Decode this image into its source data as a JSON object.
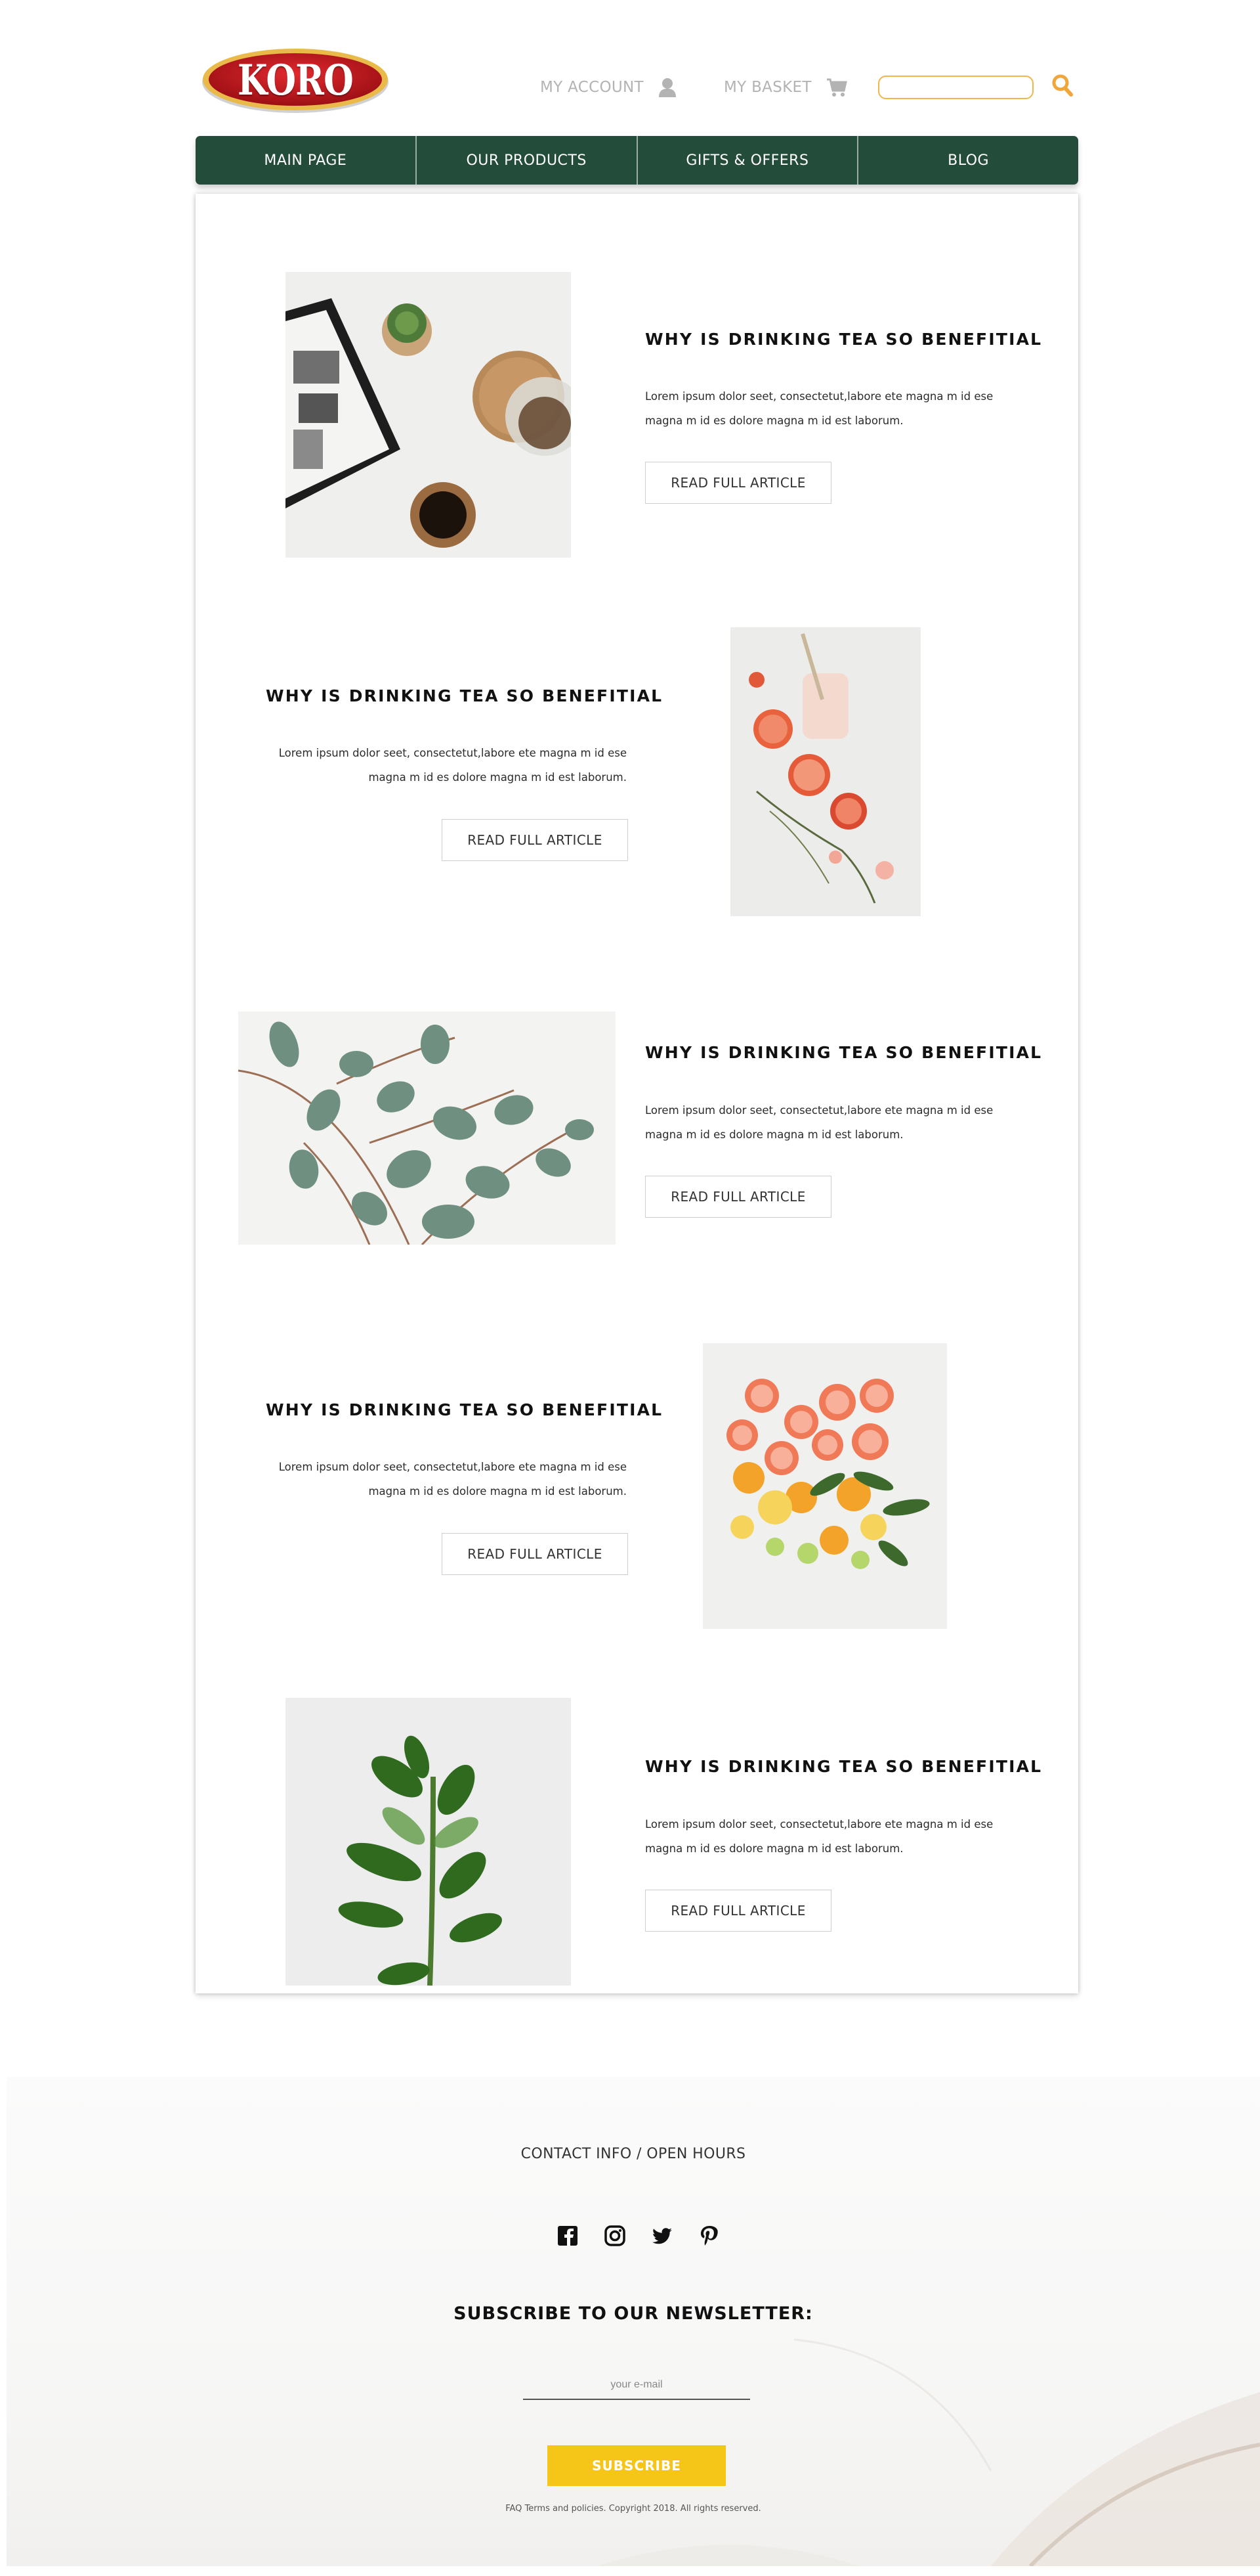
{
  "header": {
    "logo_text": "KORO",
    "account_label": "MY ACCOUNT",
    "basket_label": "MY BASKET",
    "search_placeholder": ""
  },
  "nav": {
    "items": [
      {
        "label": "MAIN PAGE"
      },
      {
        "label": "OUR PRODUCTS"
      },
      {
        "label": "GIFTS & OFFERS"
      },
      {
        "label": "BLOG"
      }
    ]
  },
  "articles": [
    {
      "title": "WHY IS DRINKING TEA SO BENEFITIAL",
      "body": "Lorem ipsum dolor seet, consectetut,labore ete magna m id ese magna m id es dolore magna m id est laborum.",
      "button": "READ FULL ARTICLE",
      "image": "coffee-table-photo"
    },
    {
      "title": "WHY IS DRINKING TEA SO BENEFITIAL",
      "body": "Lorem ipsum dolor seet, consectetut,labore ete magna m id ese magna m id es dolore magna m id est laborum.",
      "button": "READ FULL ARTICLE",
      "image": "grapefruit-drink-photo"
    },
    {
      "title": "WHY IS DRINKING TEA SO BENEFITIAL",
      "body": "Lorem ipsum dolor seet, consectetut,labore ete magna m id ese magna m id es dolore magna m id est laborum.",
      "button": "READ FULL ARTICLE",
      "image": "eucalyptus-photo"
    },
    {
      "title": "WHY IS DRINKING TEA SO BENEFITIAL",
      "body": "Lorem ipsum dolor seet, consectetut,labore ete magna m id ese magna m id es dolore magna m id est laborum.",
      "button": "READ FULL ARTICLE",
      "image": "citrus-slices-photo"
    },
    {
      "title": "WHY IS DRINKING TEA SO BENEFITIAL",
      "body": "Lorem ipsum dolor seet, consectetut,labore ete magna m id ese magna m id es dolore magna m id est laborum.",
      "button": "READ FULL ARTICLE",
      "image": "green-plant-photo"
    }
  ],
  "footer": {
    "contact": "CONTACT INFO / OPEN HOURS",
    "social_icons": [
      "facebook-icon",
      "instagram-icon",
      "twitter-icon",
      "pinterest-icon"
    ],
    "newsletter_title": "SUBSCRIBE TO OUR NEWSLETTER:",
    "email_placeholder": "your e-mail",
    "subscribe_label": "SUBSCRIBE",
    "legal": {
      "faq": "FAQ",
      "terms": "Terms and policies",
      "copyright": "Copyright 2018. All rights reserved."
    }
  },
  "colors": {
    "nav_green": "#234d3a",
    "accent_orange": "#f0a63a",
    "subscribe_yellow": "#f5c518",
    "logo_red": "#c4161c"
  }
}
